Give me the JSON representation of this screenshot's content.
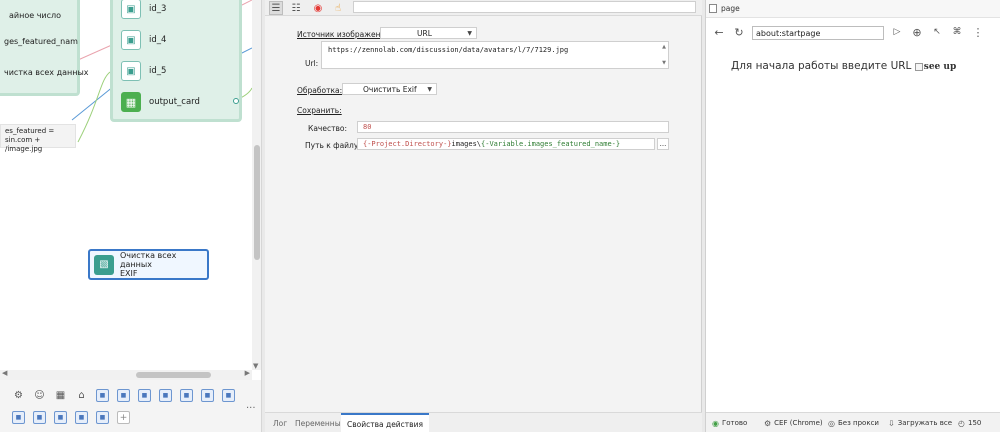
{
  "canvas": {
    "left_node": {
      "lines": [
        "айное число",
        "ges_featured_nam",
        "",
        "чистка всех данных"
      ]
    },
    "right_node": {
      "rows": [
        {
          "label": "id_3",
          "icon": "image-icon"
        },
        {
          "label": "id_4",
          "icon": "image-icon"
        },
        {
          "label": "id_5",
          "icon": "image-icon"
        },
        {
          "label": "output_card",
          "icon": "grid-icon"
        }
      ]
    },
    "variable_box": {
      "line1": "es_featured =",
      "line2": "sin.com + /image.jpg"
    },
    "selected_node": {
      "label_line1": "Очистка всех данных",
      "label_line2": "EXIF",
      "icon": "image-edit-icon"
    }
  },
  "toolbox": {
    "row1_icons": [
      "gear-icon",
      "user-icon",
      "grid-icon",
      "lock-icon"
    ],
    "more_label": "..."
  },
  "properties": {
    "source_label": "Источник изображения:",
    "source_value": "URL",
    "url_label": "Url:",
    "url_value": "https://zennolab.com/discussion/data/avatars/l/7/7129.jpg",
    "processing_label": "Обработка:",
    "processing_value": "Очистить Exif",
    "save_label": "Сохранить:",
    "quality_label": "Качество:",
    "quality_value": "80",
    "path_label": "Путь к файлу:",
    "path_value_part1": "{-Project.Directory-}",
    "path_value_part2": "images\\",
    "path_value_part3": "{-Variable.images_featured_name-}",
    "dots_label": "...",
    "tabs": [
      "Лог",
      "Переменные",
      "Свойства действия"
    ],
    "active_tab": "Свойства действия"
  },
  "browser": {
    "tab_title": "page",
    "address": "about:startpage",
    "message": "Для начала работы введите URL",
    "broken_image_alt": "see up",
    "status": {
      "ready": "Готово",
      "engine": "CEF (Chrome)",
      "proxy": "Без прокси",
      "load": "Загружать все",
      "count": "150"
    }
  },
  "colors": {
    "node_bg": "#dff0e8",
    "node_border": "#bfe0d0",
    "selection_blue": "#3a78c8",
    "record_red": "#e53935",
    "output_green": "#4caf50"
  }
}
